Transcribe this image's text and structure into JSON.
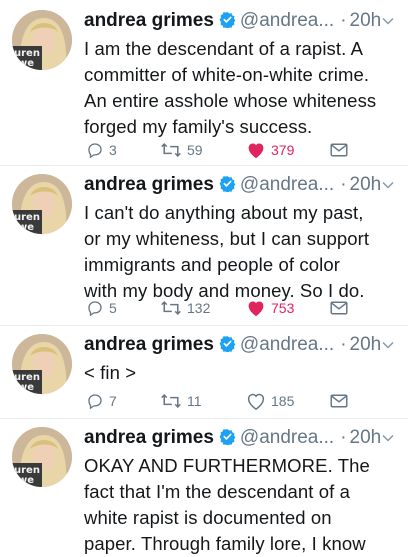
{
  "user": {
    "name": "andrea grimes",
    "handle": "@andrea...",
    "avatar_text": "uren\nwe"
  },
  "icons": {
    "verified": "verified-badge-icon",
    "caret": "chevron-down-icon",
    "reply": "reply-icon",
    "retweet": "retweet-icon",
    "like": "heart-icon",
    "dm": "envelope-icon"
  },
  "colors": {
    "verified": "#1da1f2",
    "like_active": "#e0245e",
    "muted": "#657786"
  },
  "tweets": [
    {
      "time": "20h",
      "lines": [
        "I am the descendant of a rapist. A",
        "committer of white-on-white crime.",
        "An entire asshole whose whiteness",
        "forged my family's success."
      ],
      "replies": "3",
      "retweets": "59",
      "likes": "379",
      "liked": true
    },
    {
      "time": "20h",
      "lines": [
        "I can't do anything about my past,",
        "or my whiteness, but I can support",
        "immigrants and people of color",
        "with my body and money. So I do."
      ],
      "replies": "5",
      "retweets": "132",
      "likes": "753",
      "liked": true
    },
    {
      "time": "20h",
      "lines": [
        "< fin >"
      ],
      "replies": "7",
      "retweets": "11",
      "likes": "185",
      "liked": false
    },
    {
      "time": "20h",
      "lines": [
        "OKAY AND FURTHERMORE. The",
        "fact that I'm the descendant of a",
        "white rapist is documented on",
        "paper. Through family lore, I know"
      ],
      "replies": "",
      "retweets": "",
      "likes": "",
      "liked": false
    }
  ]
}
